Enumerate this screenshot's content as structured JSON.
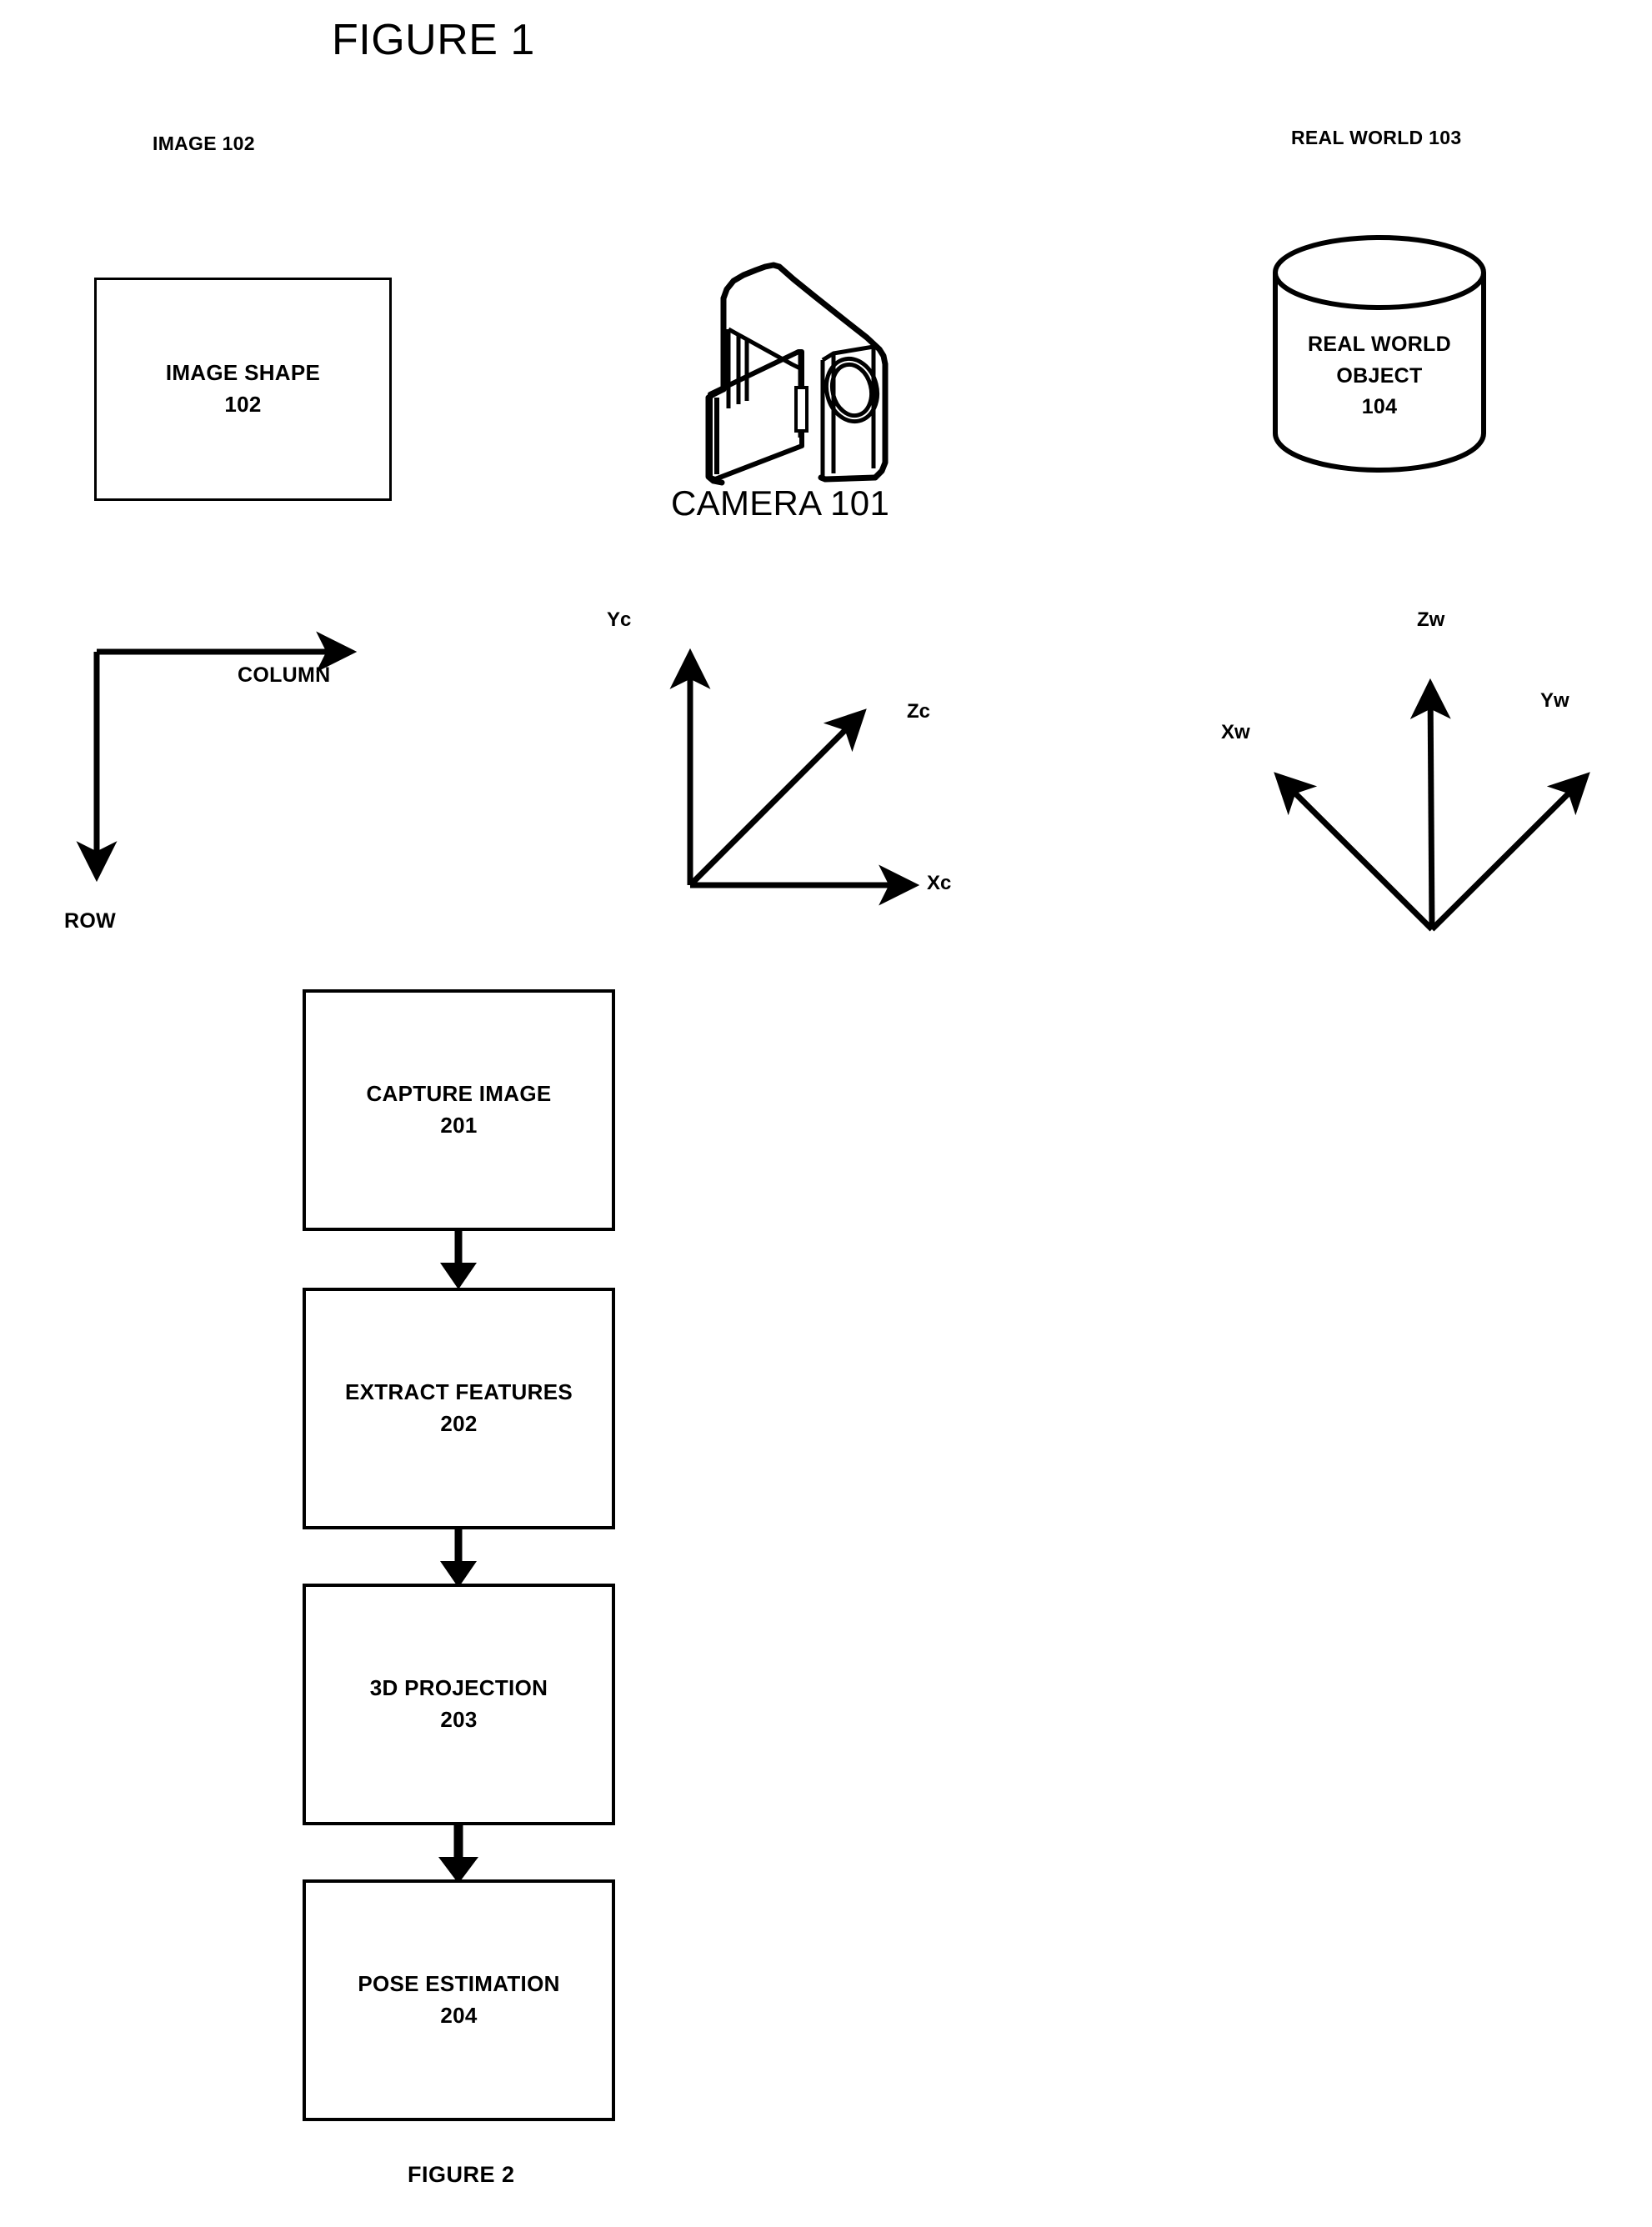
{
  "figure1": {
    "title": "FIGURE 1",
    "left_label": "IMAGE 102",
    "right_label": "REAL WORLD 103",
    "image_shape_box": "IMAGE SHAPE\n102",
    "camera_caption": "CAMERA 101",
    "real_world_object": "REAL WORLD\nOBJECT\n104",
    "image_axes": {
      "horizontal": "COLUMN",
      "vertical": "ROW"
    },
    "camera_axes": {
      "y": "Yc",
      "z": "Zc",
      "x": "Xc"
    },
    "world_axes": {
      "z": "Zw",
      "x": "Xw",
      "y": "Yw"
    }
  },
  "figure2": {
    "caption": "FIGURE 2",
    "steps": [
      {
        "label": "CAPTURE IMAGE\n201"
      },
      {
        "label": "EXTRACT FEATURES\n202"
      },
      {
        "label": "3D PROJECTION\n203"
      },
      {
        "label": "POSE ESTIMATION\n204"
      }
    ]
  },
  "colors": {
    "ink": "#000000",
    "paper": "#ffffff"
  }
}
